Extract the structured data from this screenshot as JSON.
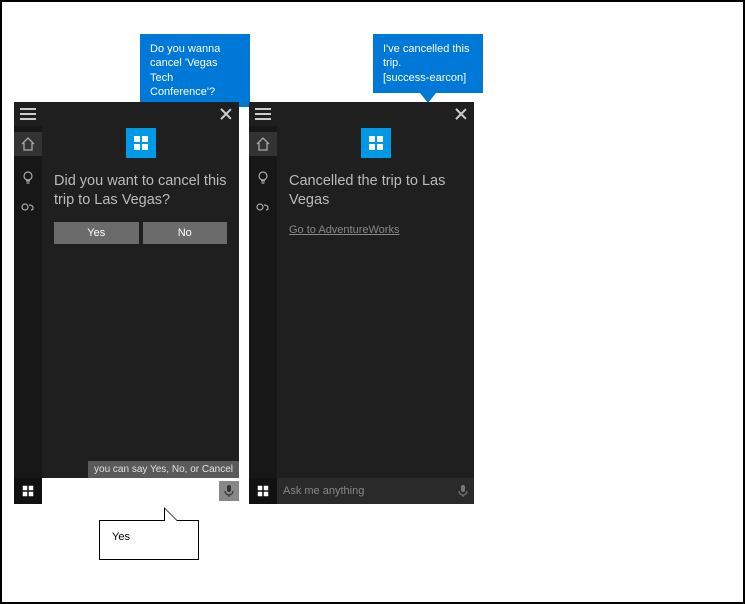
{
  "bubbles": {
    "left_tts": "Do you wanna cancel 'Vegas Tech Conference'?",
    "right_tts": "I've cancelled this trip.\n[success-earcon]",
    "user_reply": "Yes"
  },
  "panels": {
    "left": {
      "main_text": "Did you want to cancel this trip to Las Vegas?",
      "buttons": {
        "yes": "Yes",
        "no": "No"
      },
      "hint": "you can say Yes, No, or Cancel",
      "search_placeholder": ""
    },
    "right": {
      "main_text": "Cancelled the trip to Las Vegas",
      "link": "Go to AdventureWorks",
      "search_placeholder": "Ask me anything"
    }
  }
}
